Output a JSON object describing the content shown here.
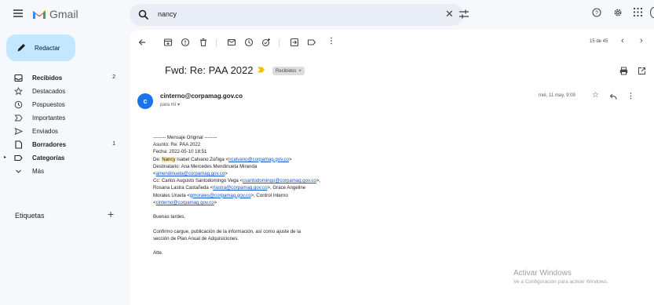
{
  "app": {
    "name": "Gmail"
  },
  "search": {
    "query": "nancy"
  },
  "sidebar": {
    "compose_label": "Redactar",
    "items": [
      {
        "label": "Recibidos",
        "count": "2",
        "bold": true
      },
      {
        "label": "Destacados",
        "count": "",
        "bold": false
      },
      {
        "label": "Pospuestos",
        "count": "",
        "bold": false
      },
      {
        "label": "Importantes",
        "count": "",
        "bold": false
      },
      {
        "label": "Enviados",
        "count": "",
        "bold": false
      },
      {
        "label": "Borradores",
        "count": "1",
        "bold": true
      },
      {
        "label": "Categorías",
        "count": "",
        "bold": true
      },
      {
        "label": "Más",
        "count": "",
        "bold": false
      }
    ],
    "labels_heading": "Etiquetas"
  },
  "toolbar": {
    "pager": "15 de 45"
  },
  "message": {
    "subject": "Fwd: Re: PAA 2022",
    "label_chip": "Recibidos",
    "label_chip_close": "×",
    "sender": "cinterno@corpamag.gov.co",
    "to": "para mí",
    "date": "mié, 11 may, 9:09",
    "avatar_letter": "c",
    "body": {
      "l1": "-------- Mensaje Original --------",
      "l2": "Asunto: Re: PAA 2022",
      "l3": "Fecha: 2022-05-10 18:51",
      "l4_pre": "De: ",
      "l4_hl": "Nancy",
      "l4_mid": " Isabel Calvano Zúñiga <",
      "l4_link": "ncalvano@corpamag.gov.co",
      "l4_end": ">",
      "l5": "Destinatario: Ana Mercedes Mendinueta Miranda",
      "l6_pre": "<",
      "l6_link": "amendinueta@corpamag.gov.co",
      "l6_end": ">",
      "l7_pre": "Cc: Carlos Augusto Santodomingo Vega <",
      "l7_link": "csantodomingo@corpamag.gov.co",
      "l7_end": ">,",
      "l8_pre": "Rosana Lastra Castañeda <",
      "l8_link": "rlastra@corpamag.gov.co",
      "l8_end": ">, Grace Angeline",
      "l9_pre": "Morales Urueta <",
      "l9_link": "gmorales@corpamag.gov.co",
      "l9_end": ">, Control Interno",
      "l10_pre": "<",
      "l10_link": "cinterno@corpamag.gov.co",
      "l10_end": ">",
      "greeting": "Buenas tardes,",
      "p1": "Confirmo cargue, publicación de la información, así como ajuste de la",
      "p2": "sección de Plan Anual de Adquisiciones.",
      "closing": "Atte."
    }
  },
  "watermark": {
    "title": "Activar Windows",
    "subtitle": "Ve a Configuración para activar Windows."
  },
  "colors": {
    "accent": "#1a73e8",
    "compose": "#c2e7ff",
    "selected": "#d3e3fd",
    "highlight": "#fce8b2",
    "chevron": "#fbbc04"
  }
}
